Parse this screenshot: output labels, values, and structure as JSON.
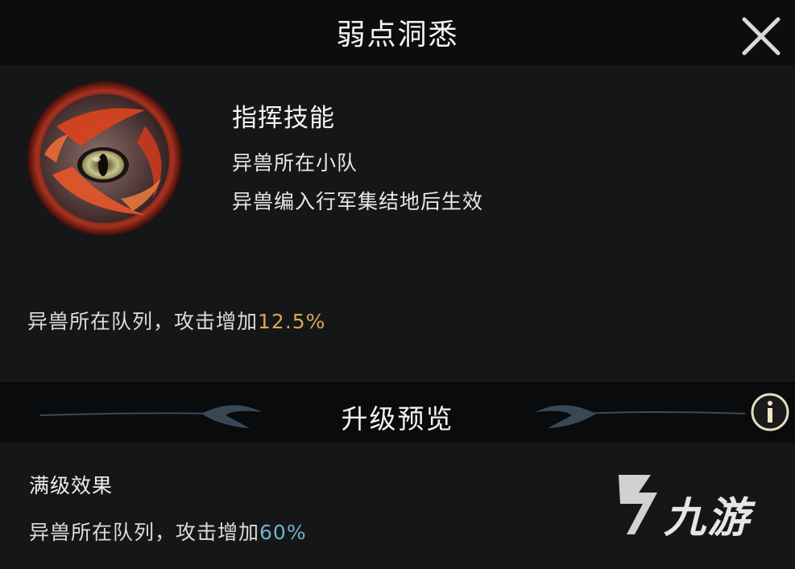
{
  "header": {
    "title": "弱点洞悉",
    "close_icon": "close-icon"
  },
  "skill": {
    "icon": "beast-eye-icon",
    "name": "指挥技能",
    "lines": [
      "异兽所在小队",
      "异兽编入行军集结地后生效"
    ],
    "current_effect_prefix": "异兽所在队列，攻击增加",
    "current_effect_value": "12.5%"
  },
  "upgrade_preview": {
    "title": "升级预览",
    "info_icon": "info-icon",
    "max_label": "满级效果",
    "max_effect_prefix": "异兽所在队列，攻击增加",
    "max_effect_value": "60%"
  },
  "watermark": {
    "text": "九游"
  },
  "colors": {
    "highlight_current": "#d9a557",
    "highlight_max": "#6fb3c7",
    "background": "#121315"
  }
}
